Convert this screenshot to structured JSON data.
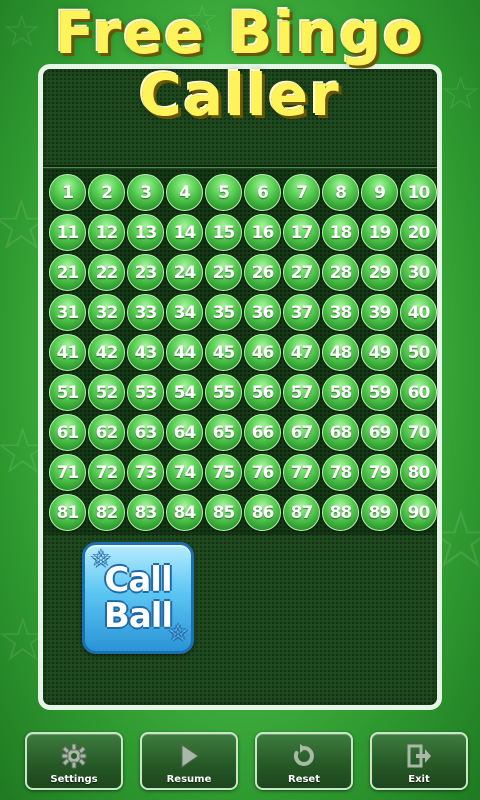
{
  "title": {
    "line1": "Free Bingo",
    "line2": "Caller"
  },
  "balls": [
    "1",
    "2",
    "3",
    "4",
    "5",
    "6",
    "7",
    "8",
    "9",
    "10",
    "11",
    "12",
    "13",
    "14",
    "15",
    "16",
    "17",
    "18",
    "19",
    "20",
    "21",
    "22",
    "23",
    "24",
    "25",
    "26",
    "27",
    "28",
    "29",
    "30",
    "31",
    "32",
    "33",
    "34",
    "35",
    "36",
    "37",
    "38",
    "39",
    "40",
    "41",
    "42",
    "43",
    "44",
    "45",
    "46",
    "47",
    "48",
    "49",
    "50",
    "51",
    "52",
    "53",
    "54",
    "55",
    "56",
    "57",
    "58",
    "59",
    "60",
    "61",
    "62",
    "63",
    "64",
    "65",
    "66",
    "67",
    "68",
    "69",
    "70",
    "71",
    "72",
    "73",
    "74",
    "75",
    "76",
    "77",
    "78",
    "79",
    "80",
    "81",
    "82",
    "83",
    "84",
    "85",
    "86",
    "87",
    "88",
    "89",
    "90"
  ],
  "call_ball": {
    "line1": "Call",
    "line2": "Ball"
  },
  "toolbar": [
    {
      "label": "Settings",
      "icon": "gear-icon"
    },
    {
      "label": "Resume",
      "icon": "play-icon"
    },
    {
      "label": "Reset",
      "icon": "reset-icon"
    },
    {
      "label": "Exit",
      "icon": "exit-icon"
    }
  ],
  "colors": {
    "background": "#4cc04a",
    "board": "#1f4a1f",
    "ball": "#5fd45a",
    "title": "#fff35a",
    "call_button": "#5cc6f2"
  }
}
